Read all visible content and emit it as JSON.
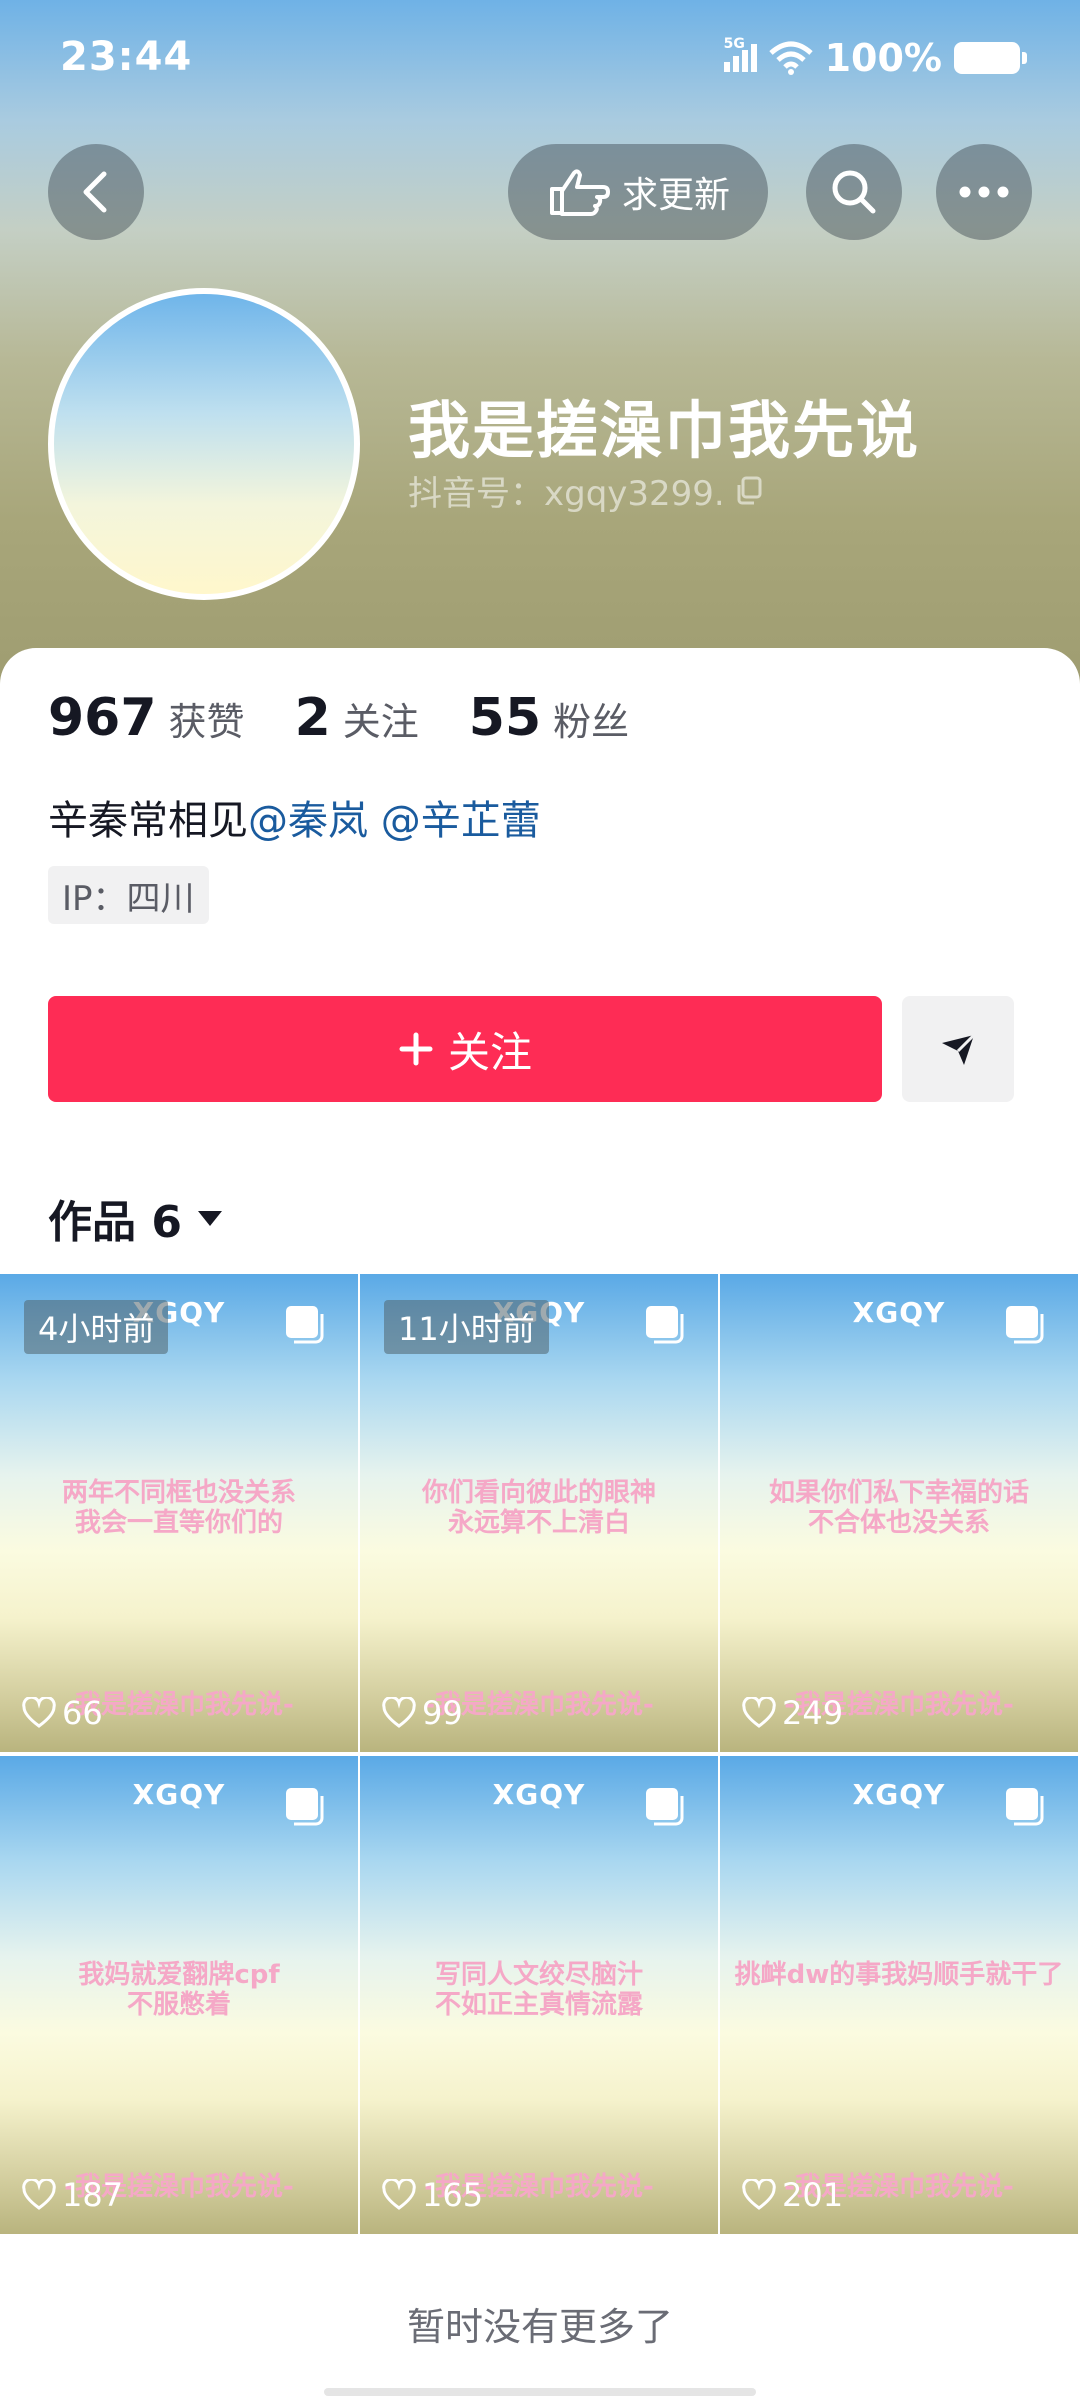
{
  "status_bar": {
    "time": "23:44",
    "network": "5G",
    "battery": "100%"
  },
  "header": {
    "request_update_label": "求更新",
    "username": "我是搓澡巾我先说",
    "douyin_id": "抖音号：xgqy3299."
  },
  "stats": {
    "likes": {
      "value": "967",
      "label": "获赞"
    },
    "following": {
      "value": "2",
      "label": "关注"
    },
    "followers": {
      "value": "55",
      "label": "粉丝"
    }
  },
  "bio": {
    "text": "辛秦常相见",
    "mention1": "@秦岚",
    "mention2": "@辛芷蕾"
  },
  "ip": "IP：四川",
  "follow_label": "关注",
  "works_tab": "作品 6",
  "videos": [
    {
      "brand": "XGQY",
      "caption": "两年不同框也没关系\n我会一直等你们的",
      "footer": "-我是搓澡巾我先说-",
      "time": "4小时前",
      "likes": "66"
    },
    {
      "brand": "XGQY",
      "caption": "你们看向彼此的眼神\n永远算不上清白",
      "footer": "-我是搓澡巾我先说-",
      "time": "11小时前",
      "likes": "99"
    },
    {
      "brand": "XGQY",
      "caption": "如果你们私下幸福的话\n不合体也没关系",
      "footer": "-我是搓澡巾我先说-",
      "time": "",
      "likes": "249"
    },
    {
      "brand": "XGQY",
      "caption": "我妈就爱翻牌cpf\n不服憋着",
      "footer": "-我是搓澡巾我先说-",
      "time": "",
      "likes": "187"
    },
    {
      "brand": "XGQY",
      "caption": "写同人文绞尽脑汁\n不如正主真情流露",
      "footer": "-我是搓澡巾我先说-",
      "time": "",
      "likes": "165"
    },
    {
      "brand": "XGQY",
      "caption": "挑衅dw的事我妈顺手就干了",
      "footer": "-我是搓澡巾我先说-",
      "time": "",
      "likes": "201"
    }
  ],
  "footer_note": "暂时没有更多了"
}
